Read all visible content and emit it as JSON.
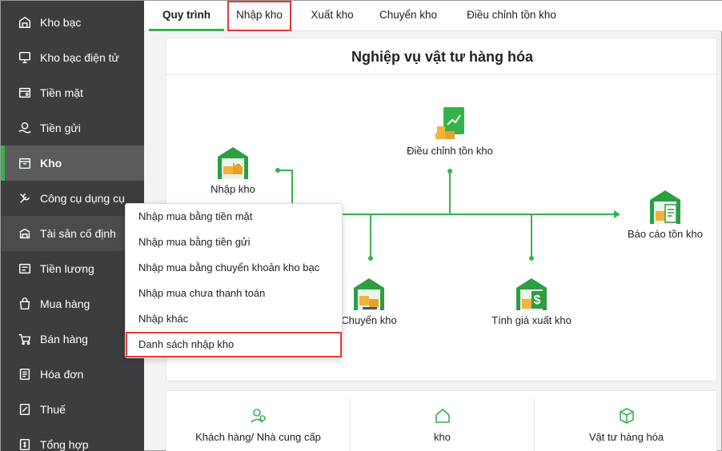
{
  "sidebar": {
    "items": [
      {
        "label": "Kho bạc",
        "icon": "bank-icon"
      },
      {
        "label": "Kho bạc điện tử",
        "icon": "monitor-icon"
      },
      {
        "label": "Tiền mặt",
        "icon": "cash-icon"
      },
      {
        "label": "Tiền gửi",
        "icon": "deposit-icon"
      },
      {
        "label": "Kho",
        "icon": "warehouse-icon"
      },
      {
        "label": "Công cụ dụng cụ",
        "icon": "tools-icon"
      },
      {
        "label": "Tài sản cố định",
        "icon": "asset-icon"
      },
      {
        "label": "Tiền lương",
        "icon": "salary-icon"
      },
      {
        "label": "Mua hàng",
        "icon": "shopping-bag-icon"
      },
      {
        "label": "Bán hàng",
        "icon": "cart-icon"
      },
      {
        "label": "Hóa đơn",
        "icon": "invoice-icon"
      },
      {
        "label": "Thuế",
        "icon": "tax-icon"
      },
      {
        "label": "Tổng hợp",
        "icon": "summary-icon"
      }
    ],
    "active": "Kho"
  },
  "tabs": [
    "Quy trình",
    "Nhập kho",
    "Xuất kho",
    "Chuyển kho",
    "Điều chỉnh tồn kho"
  ],
  "main": {
    "title": "Nghiệp vụ vật tư hàng hóa",
    "nodes": {
      "nhap_kho": "Nhập kho",
      "dieu_chinh": "Điều chỉnh tồn kho",
      "bao_cao": "Báo cáo tồn kho",
      "chuyen_kho": "Chuyển kho",
      "tinh_gia": "Tính giá xuất kho"
    }
  },
  "dropdown": {
    "items": [
      "Nhập mua bằng tiền mặt",
      "Nhập mua bằng tiền gửi",
      "Nhập mua bằng chuyển khoản kho bạc",
      "Nhập mua chưa thanh toán",
      "Nhập khác",
      "Danh sách nhập kho"
    ]
  },
  "bottom": {
    "items": [
      {
        "label": "Khách hàng/ Nhà cung cấp",
        "icon": "customer-icon"
      },
      {
        "label": "kho",
        "icon": "home-icon"
      },
      {
        "label": "Vật tư hàng hóa",
        "icon": "box-icon"
      }
    ]
  },
  "colors": {
    "accent": "#35b34a",
    "sidebar_bg": "#3c3d3f",
    "highlight": "#e03b3b"
  }
}
